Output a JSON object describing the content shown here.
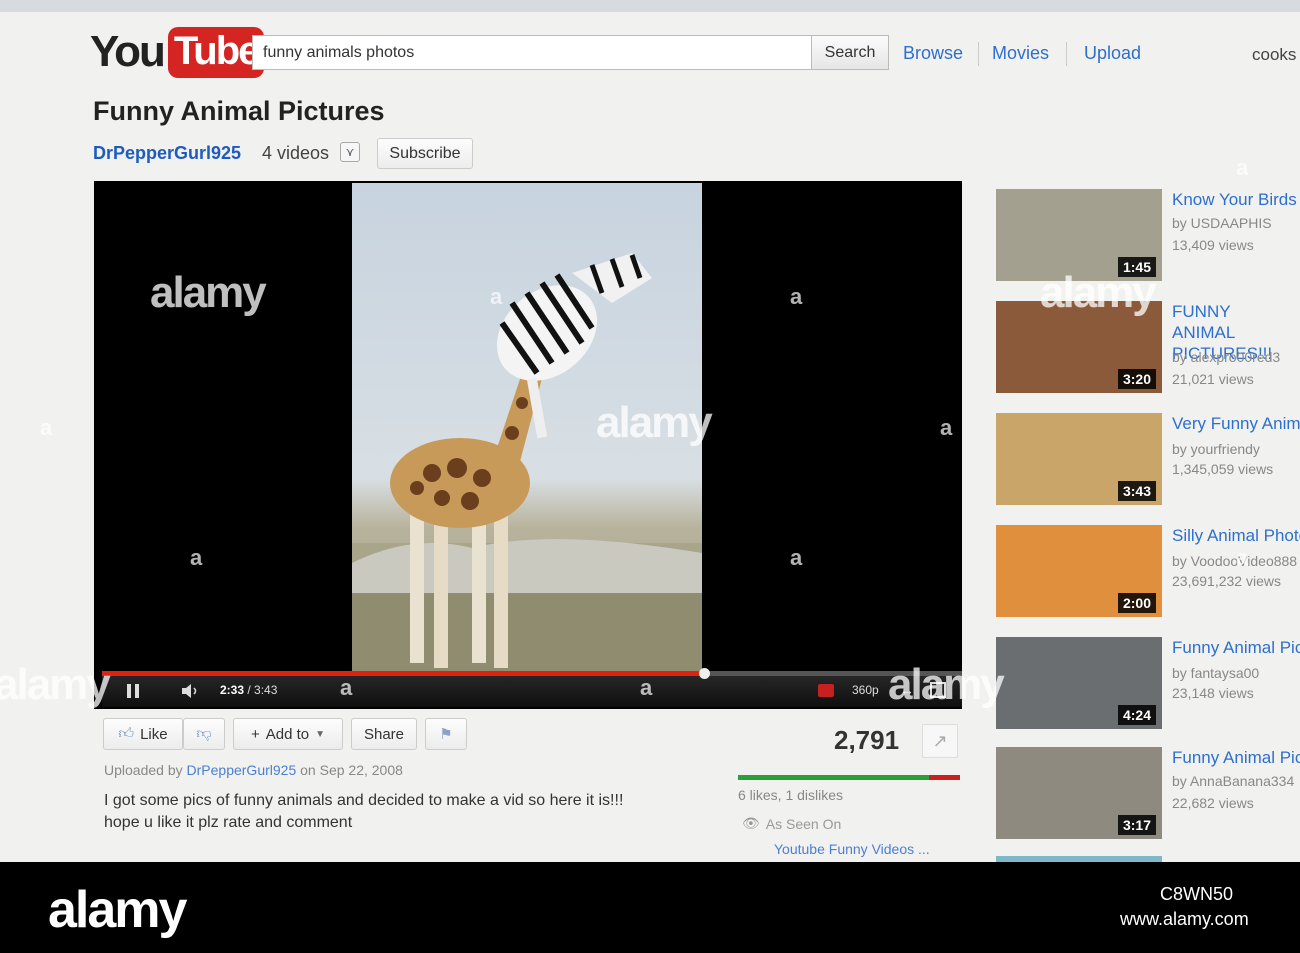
{
  "header": {
    "logo_you": "You",
    "logo_tube": "Tube",
    "search_value": "funny animals photos",
    "search_button": "Search",
    "nav": [
      "Browse",
      "Movies",
      "Upload"
    ],
    "user": "cooks"
  },
  "video": {
    "title": "Funny Animal Pictures",
    "channel": "DrPepperGurl925",
    "channel_video_count": "4 videos",
    "subscribe": "Subscribe",
    "current_time": "2:33",
    "duration": "/ 3:43",
    "progress": 0.7,
    "quality": "360p"
  },
  "actions": {
    "like": "Like",
    "add_to": "Add to",
    "share": "Share"
  },
  "stats": {
    "view_count": "2,791",
    "like_ratio": 0.86,
    "likes_text": "6 likes, 1 dislikes",
    "as_seen_on": "As Seen On",
    "seen_link": "Youtube Funny Videos ..."
  },
  "upload": {
    "prefix": "Uploaded by",
    "uploader": "DrPepperGurl925",
    "date": "on Sep 22, 2008",
    "description_line1": "I got some pics of funny animals and decided to make a vid so here it is!!!",
    "description_line2": "hope u like it plz rate and comment"
  },
  "sidebar": [
    {
      "title": "Know Your Birds",
      "by": "by USDAAPHIS",
      "views": "13,409 views",
      "duration": "1:45",
      "color": "#a4a090"
    },
    {
      "title": "FUNNY ANIMAL PICTURES!!!",
      "by": "by alexpro00red3",
      "views": "21,021 views",
      "duration": "3:20",
      "color": "#8a5a3a"
    },
    {
      "title": "Very Funny Animals",
      "by": "by yourfriendy",
      "views": "1,345,059 views",
      "duration": "3:43",
      "color": "#c9a56a"
    },
    {
      "title": "Silly Animal Photos",
      "by": "by VoodooVideo888",
      "views": "23,691,232 views",
      "duration": "2:00",
      "color": "#e08f3c"
    },
    {
      "title": "Funny Animal Pictures",
      "by": "by fantaysa00",
      "views": "23,148 views",
      "duration": "4:24",
      "color": "#6a6e70"
    },
    {
      "title": "Funny Animal Pictures",
      "by": "by AnnaBanana334",
      "views": "22,682 views",
      "duration": "3:17",
      "color": "#8e8a80"
    }
  ],
  "watermark": {
    "brand": "alamy",
    "glyph": "a"
  },
  "banner": {
    "brand": "alamy",
    "image_id": "C8WN50",
    "url": "www.alamy.com"
  }
}
